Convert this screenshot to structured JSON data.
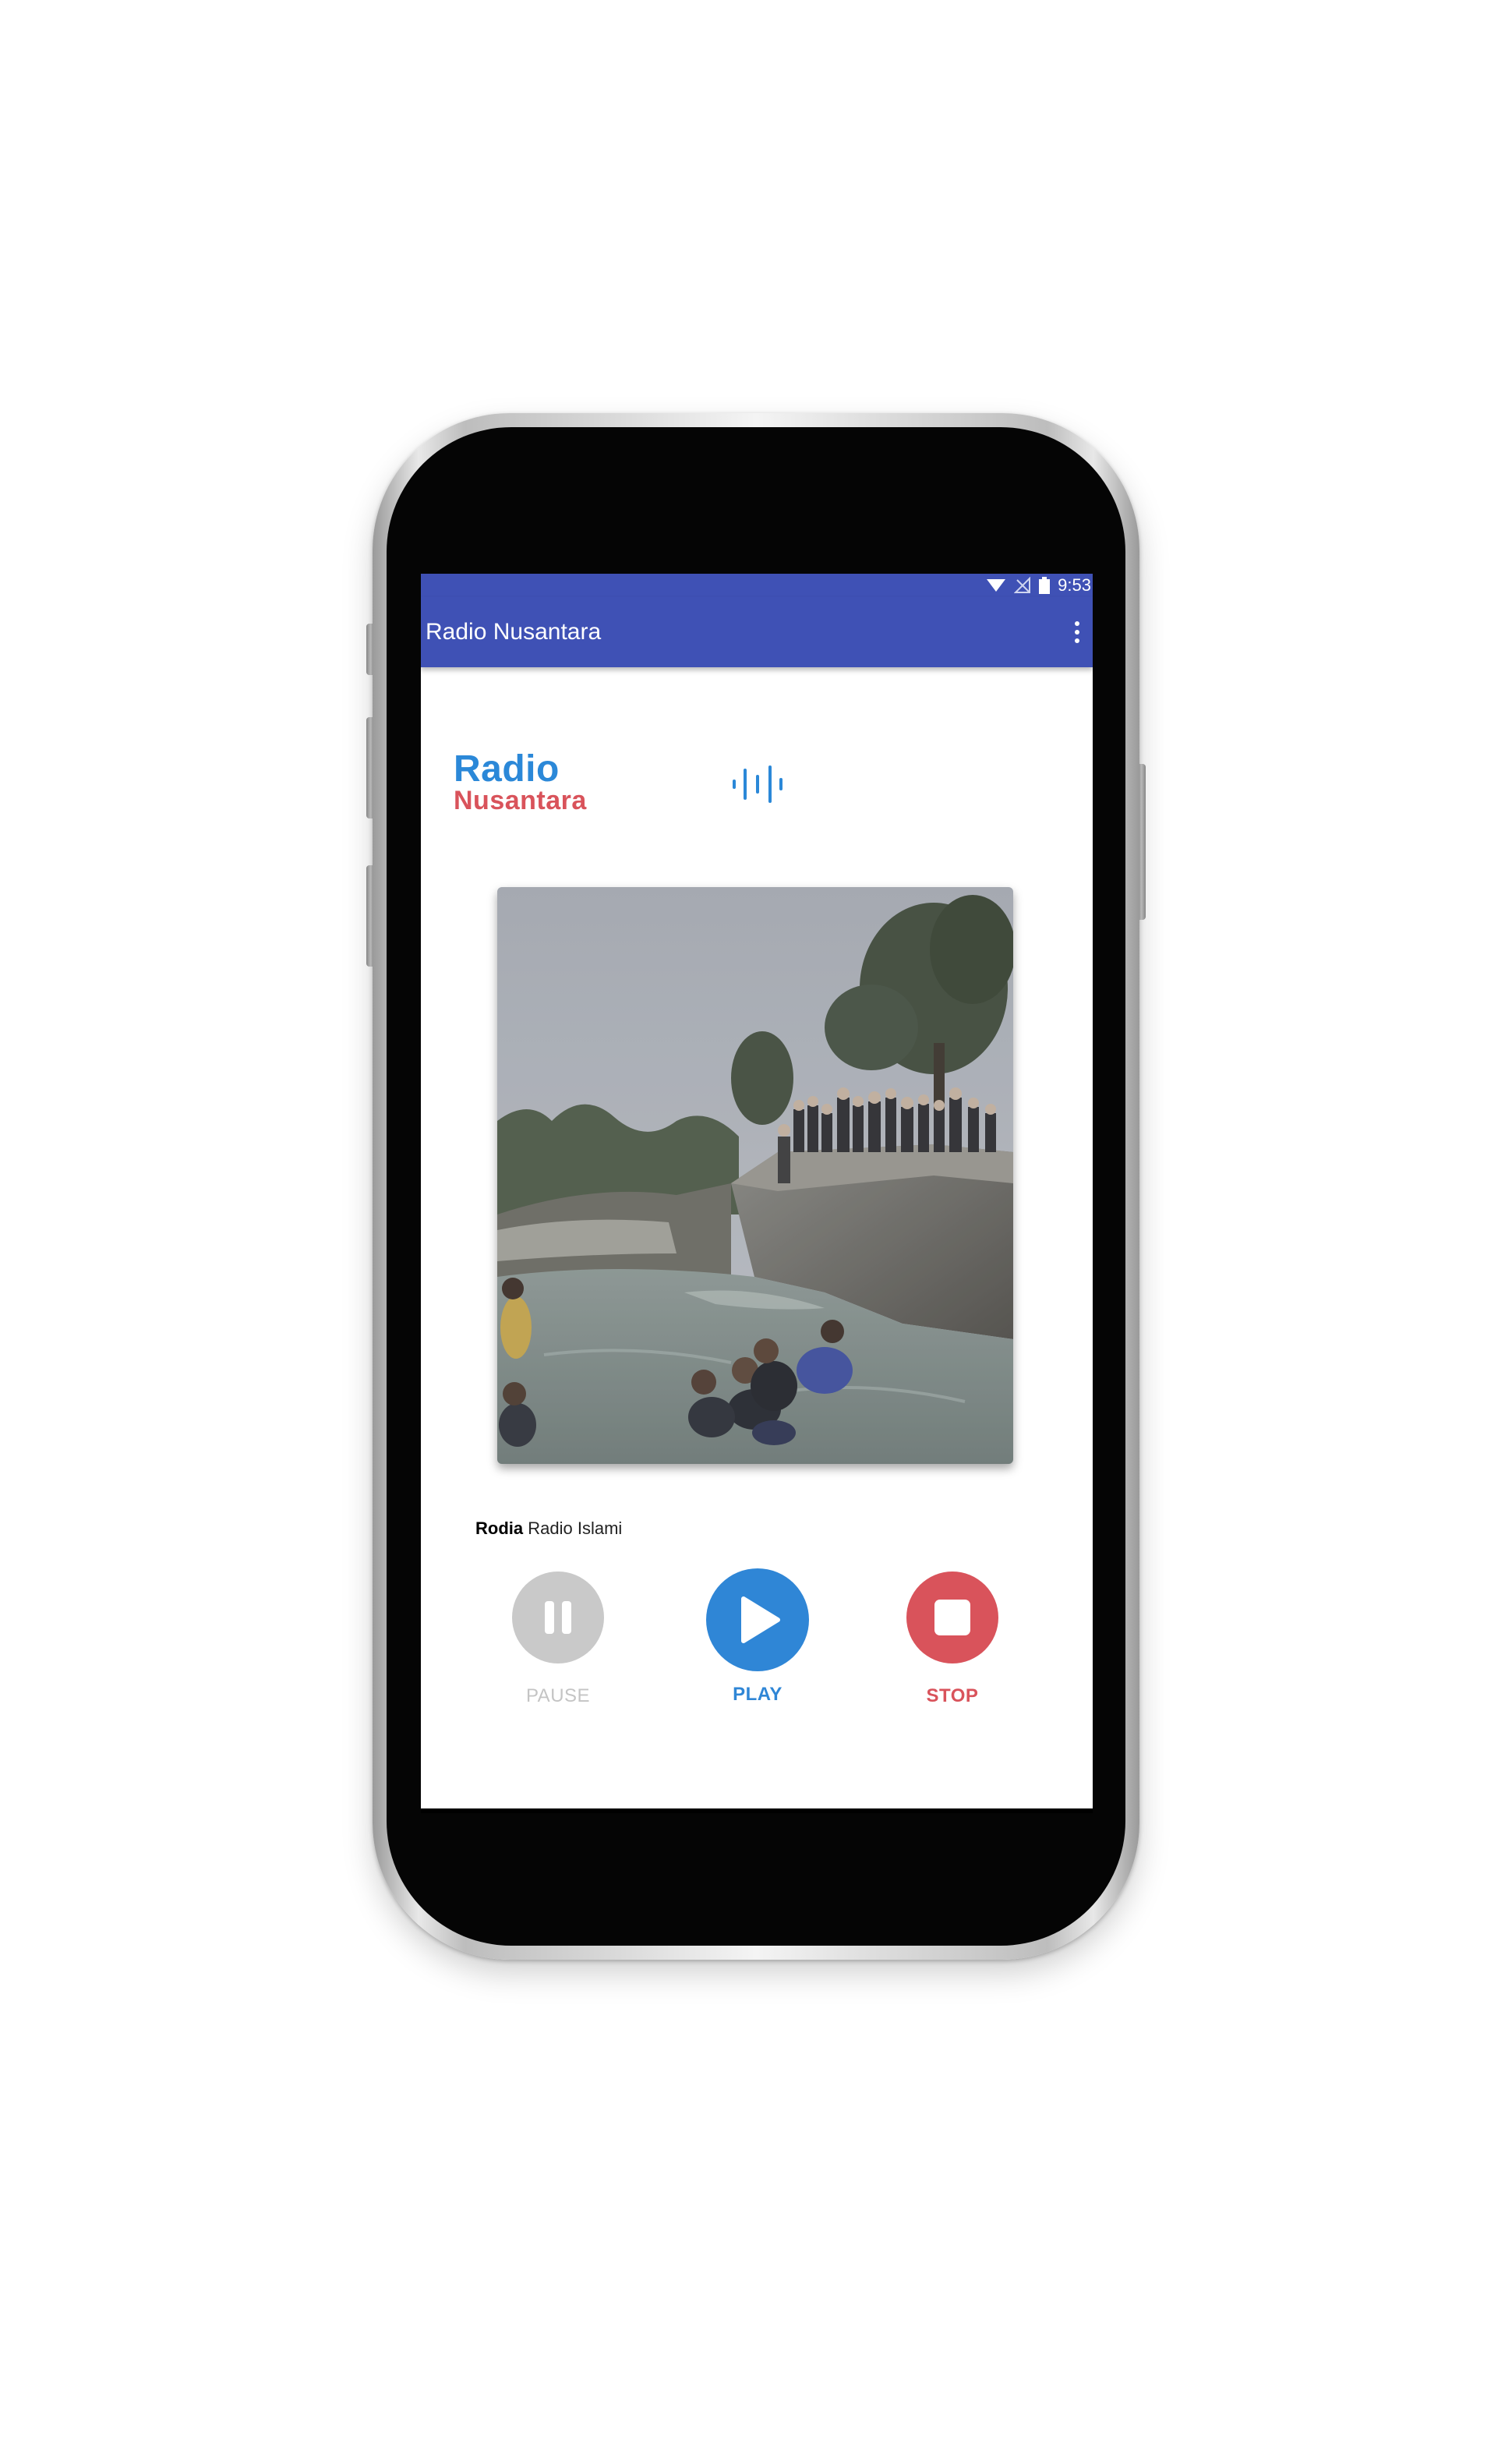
{
  "status_bar": {
    "time": "9:53",
    "icons": [
      "wifi-icon",
      "no-signal-icon",
      "battery-icon"
    ]
  },
  "app_bar": {
    "title": "Radio Nusantara",
    "menu_icon": "overflow-menu-icon"
  },
  "logo": {
    "line1": "Radio",
    "line2": "Nusantara",
    "wave_icon": "audio-wave-icon"
  },
  "now_playing": {
    "station": "Rodia",
    "description": "Radio Islami"
  },
  "controls": {
    "pause_label": "PAUSE",
    "play_label": "PLAY",
    "stop_label": "STOP"
  },
  "colors": {
    "app_bar": "#3f51b5",
    "brand_blue": "#2b88d8",
    "brand_red": "#d9535b",
    "pause_grey": "#c9c9c9"
  }
}
